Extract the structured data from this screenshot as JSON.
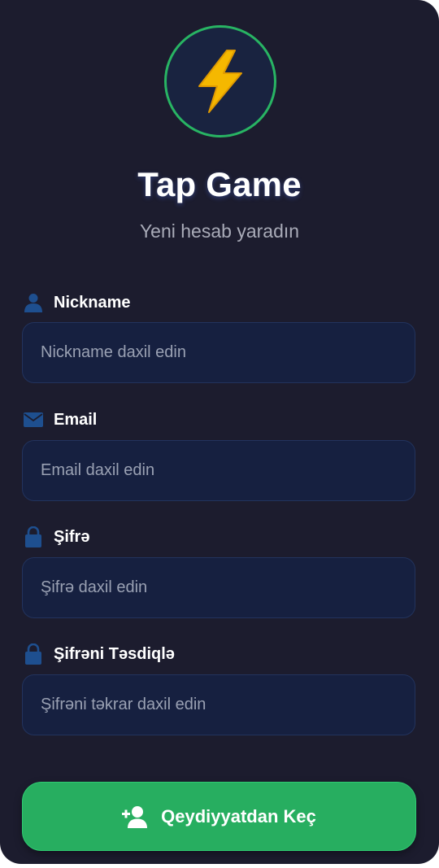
{
  "app": {
    "title": "Tap Game",
    "subtitle": "Yeni hesab yaradın",
    "logo_icon": "lightning-bolt-icon"
  },
  "form": {
    "fields": [
      {
        "icon": "user-icon",
        "label": "Nickname",
        "placeholder": "Nickname daxil edin",
        "value": ""
      },
      {
        "icon": "envelope-icon",
        "label": "Email",
        "placeholder": "Email daxil edin",
        "value": ""
      },
      {
        "icon": "lock-icon",
        "label": "Şifrə",
        "placeholder": "Şifrə daxil edin",
        "value": ""
      },
      {
        "icon": "lock-icon",
        "label": "Şifrəni Təsdiqlə",
        "placeholder": "Şifrəni təkrar daxil edin",
        "value": ""
      }
    ],
    "submit": {
      "icon": "user-plus-icon",
      "label": "Qeydiyyatdan Keç"
    }
  },
  "colors": {
    "background": "#1c1c2e",
    "accent": "#27ae60",
    "field_bg": "#162040",
    "icon": "#1e4f8f"
  }
}
